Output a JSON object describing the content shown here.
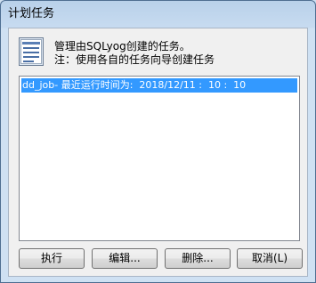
{
  "window": {
    "title": "计划任务"
  },
  "header": {
    "icon": "schedule-list-icon",
    "line1": "管理由SQLyog创建的任务。",
    "line2": "注：使用各自的任务向导创建任务"
  },
  "list": {
    "items": [
      {
        "text": "dd_job- 最近运行时间为:  2018/12/11 :  10 :  10",
        "selected": true
      }
    ]
  },
  "buttons": {
    "run": "执行",
    "edit": "编辑...",
    "delete": "删除...",
    "cancel": "取消(L)"
  },
  "colors": {
    "selection": "#3399ff",
    "window_frame": "#b9d1ea"
  }
}
